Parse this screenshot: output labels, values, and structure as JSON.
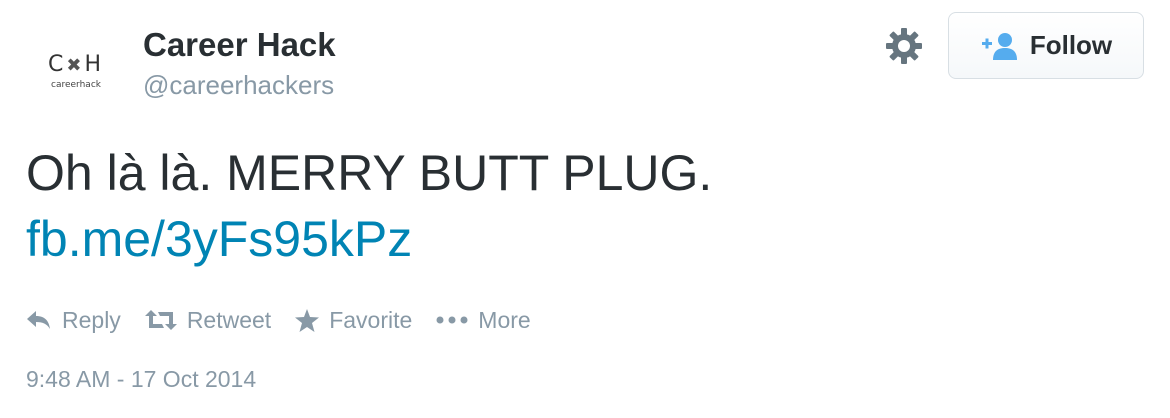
{
  "profile": {
    "avatar_mark_left": "C",
    "avatar_mark_x": "✖",
    "avatar_mark_right": "H",
    "avatar_wordmark": "careerhack",
    "name": "Career Hack",
    "handle": "@careerhackers"
  },
  "header": {
    "follow_label": "Follow",
    "gear_icon": "gear-icon",
    "follow_icon": "add-user-icon"
  },
  "tweet": {
    "text": "Oh là là. MERRY BUTT PLUG.",
    "link": "fb.me/3yFs95kPz"
  },
  "actions": {
    "reply": "Reply",
    "retweet": "Retweet",
    "favorite": "Favorite",
    "more": "More"
  },
  "timestamp": "9:48 AM - 17 Oct 2014",
  "colors": {
    "text": "#292f33",
    "muted": "#8899a6",
    "link": "#0084b4",
    "follow_icon": "#55acee"
  }
}
